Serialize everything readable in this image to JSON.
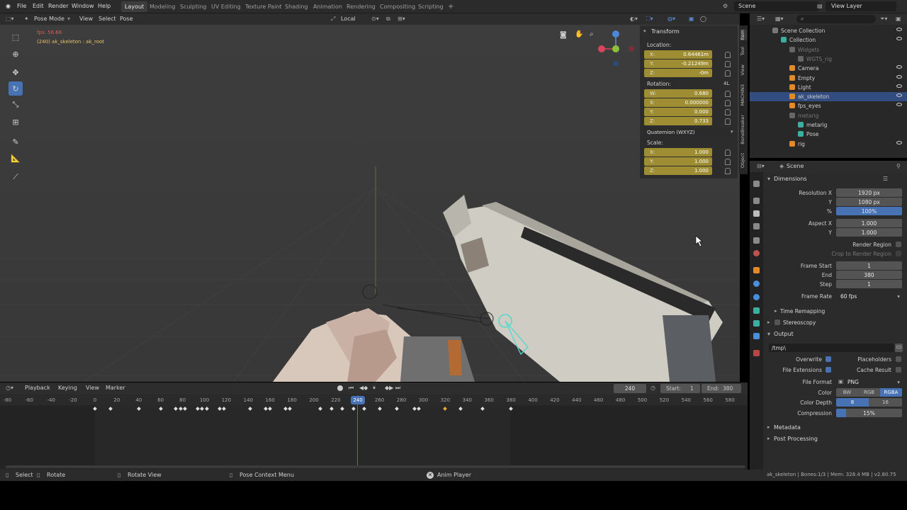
{
  "menubar": {
    "items": [
      "File",
      "Edit",
      "Render",
      "Window",
      "Help"
    ],
    "workspaces": [
      "Layout",
      "Modeling",
      "Sculpting",
      "UV Editing",
      "Texture Paint",
      "Shading",
      "Animation",
      "Rendering",
      "Compositing",
      "Scripting"
    ],
    "active_workspace": "Layout",
    "add_tab": "+",
    "scene": "Scene",
    "view_layer": "View Layer"
  },
  "viewport_header": {
    "mode": "Pose Mode",
    "menus": [
      "View",
      "Select",
      "Pose"
    ],
    "orientation": "Local"
  },
  "overlay": {
    "fps": "fps: 56.66",
    "info": "(240) ak_skeleton : ak_root"
  },
  "transform": {
    "title": "Transform",
    "location_label": "Location:",
    "location": [
      {
        "axis": "X:",
        "value": "0.64461m"
      },
      {
        "axis": "Y:",
        "value": "-0.21249m"
      },
      {
        "axis": "Z:",
        "value": "-0m"
      }
    ],
    "rotation_label": "Rotation:",
    "rotation_mode_badge": "4L",
    "rotation": [
      {
        "axis": "W:",
        "value": "0.680"
      },
      {
        "axis": "X:",
        "value": "0.000000"
      },
      {
        "axis": "Y:",
        "value": "0.000"
      },
      {
        "axis": "Z:",
        "value": "0.733"
      }
    ],
    "rotation_mode": "Quaternion (WXYZ)",
    "scale_label": "Scale:",
    "scale": [
      {
        "axis": "X:",
        "value": "1.000"
      },
      {
        "axis": "Y:",
        "value": "1.000"
      },
      {
        "axis": "Z:",
        "value": "1.000"
      }
    ]
  },
  "sidebar_tabs": [
    "Item",
    "Tool",
    "View",
    "MACHIN3",
    "BoneBreaker",
    "Object"
  ],
  "timeline": {
    "menus": [
      "Playback",
      "Keying",
      "View",
      "Marker"
    ],
    "current_frame": "240",
    "start_label": "Start:",
    "start": "1",
    "end_label": "End:",
    "end": "380",
    "ruler": [
      "-80",
      "-60",
      "-40",
      "-20",
      "0",
      "20",
      "40",
      "60",
      "80",
      "100",
      "120",
      "140",
      "160",
      "180",
      "200",
      "220",
      "240",
      "260",
      "280",
      "300",
      "320",
      "340",
      "360",
      "380",
      "400",
      "420",
      "440",
      "460",
      "480",
      "500",
      "520",
      "540",
      "560",
      "580"
    ],
    "playhead_label": "240"
  },
  "statusbar": {
    "select": "Select",
    "rotate": "Rotate",
    "rotate_view": "Rotate View",
    "context": "Pose Context Menu",
    "addon": "Anim Player",
    "stats": "ak_skeleton | Bones:1/3 | Mem: 328.4 MB | v2.80.75"
  },
  "outliner": {
    "rows": [
      {
        "name": "Scene Collection",
        "indent": 0,
        "selected": false,
        "dim": false
      },
      {
        "name": "Collection",
        "indent": 1,
        "selected": false,
        "dim": false
      },
      {
        "name": "Widgets",
        "indent": 2,
        "selected": false,
        "dim": true
      },
      {
        "name": "WGTS_rig",
        "indent": 3,
        "selected": false,
        "dim": true
      },
      {
        "name": "Camera",
        "indent": 2,
        "selected": false,
        "dim": false
      },
      {
        "name": "Empty",
        "indent": 2,
        "selected": false,
        "dim": false
      },
      {
        "name": "Light",
        "indent": 2,
        "selected": false,
        "dim": false
      },
      {
        "name": "ak_skeleton",
        "indent": 2,
        "selected": true,
        "dim": false
      },
      {
        "name": "fps_eyes",
        "indent": 2,
        "selected": false,
        "dim": false
      },
      {
        "name": "metarig",
        "indent": 2,
        "selected": false,
        "dim": true
      },
      {
        "name": "metarig",
        "indent": 3,
        "selected": false,
        "dim": false
      },
      {
        "name": "Pose",
        "indent": 3,
        "selected": false,
        "dim": false
      },
      {
        "name": "rig",
        "indent": 2,
        "selected": false,
        "dim": false
      }
    ]
  },
  "properties": {
    "header": "Scene",
    "dimensions_title": "Dimensions",
    "fields": [
      {
        "label": "Resolution X",
        "value": "1920 px",
        "blue": false
      },
      {
        "label": "Y",
        "value": "1080 px",
        "blue": false
      },
      {
        "label": "%",
        "value": "100%",
        "blue": true
      },
      {
        "label": "Aspect X",
        "value": "1.000",
        "blue": false
      },
      {
        "label": "Y",
        "value": "1.000",
        "blue": false
      }
    ],
    "render_region": "Render Region",
    "crop": "Crop to Render Region",
    "frame_fields": [
      {
        "label": "Frame Start",
        "value": "1"
      },
      {
        "label": "End",
        "value": "380"
      },
      {
        "label": "Step",
        "value": "1"
      }
    ],
    "frame_rate_label": "Frame Rate",
    "frame_rate": "60 fps",
    "time_remapping": "Time Remapping",
    "stereoscopy": "Stereoscopy",
    "output_title": "Output",
    "output_path": "/tmp\\",
    "overwrite": "Overwrite",
    "placeholders": "Placeholders",
    "file_extensions": "File Extensions",
    "cache_result": "Cache Result",
    "file_format_label": "File Format",
    "file_format": "PNG",
    "color_label": "Color",
    "color_options": [
      "BW",
      "RGB",
      "RGBA"
    ],
    "color_selected": "RGBA",
    "color_depth_label": "Color Depth",
    "color_depth": [
      "8",
      "16"
    ],
    "compression_label": "Compression",
    "compression": "15%",
    "compression_level": 0.15,
    "metadata": "Metadata",
    "post_processing": "Post Processing"
  },
  "colors": {
    "accent": "#4772b3",
    "keyed": "#9e8d33",
    "selected_row": "#334d80"
  }
}
